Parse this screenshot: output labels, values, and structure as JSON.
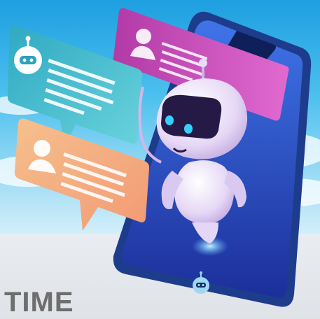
{
  "caption": {
    "text": "TIME"
  },
  "colors": {
    "sky_top": "#1e9fe0",
    "sky_bottom": "#d7f0fa",
    "floor": "#e5e9ed",
    "phone_frame": "#1f3f8f",
    "phone_screen": "#2a5bd6",
    "bubble_teal": "#3bb7c9",
    "bubble_magenta": "#c73fae",
    "bubble_peach": "#f3b987",
    "robot_body": "#e8dcf5",
    "robot_visor": "#2b1f4a",
    "robot_eye": "#35d0ff",
    "caption": "#6e6e6e"
  },
  "icons": [
    "robot-avatar-icon",
    "user-avatar-icon",
    "user-avatar-icon",
    "robot-avatar-icon"
  ]
}
